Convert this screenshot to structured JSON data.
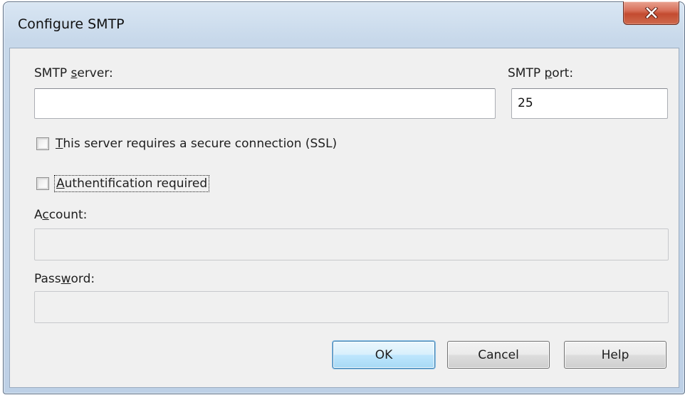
{
  "window": {
    "title": "Configure SMTP"
  },
  "form": {
    "smtp_server": {
      "label_pre": "SMTP ",
      "label_accel": "s",
      "label_post": "erver:",
      "value": ""
    },
    "smtp_port": {
      "label_pre": "SMTP ",
      "label_accel": "p",
      "label_post": "ort:",
      "value": "25"
    },
    "ssl_checkbox": {
      "label_accel": "T",
      "label_post": "his server requires a secure connection (SSL)",
      "checked": false
    },
    "auth_checkbox": {
      "label_accel": "A",
      "label_post": "uthentification required",
      "checked": false
    },
    "account": {
      "label_pre": "A",
      "label_accel": "c",
      "label_post": "count:",
      "value": ""
    },
    "password": {
      "label_pre": "Pass",
      "label_accel": "w",
      "label_post": "ord:",
      "value": ""
    }
  },
  "buttons": {
    "ok": "OK",
    "cancel": "Cancel",
    "help": "Help"
  },
  "icons": {
    "close": "close-icon"
  }
}
